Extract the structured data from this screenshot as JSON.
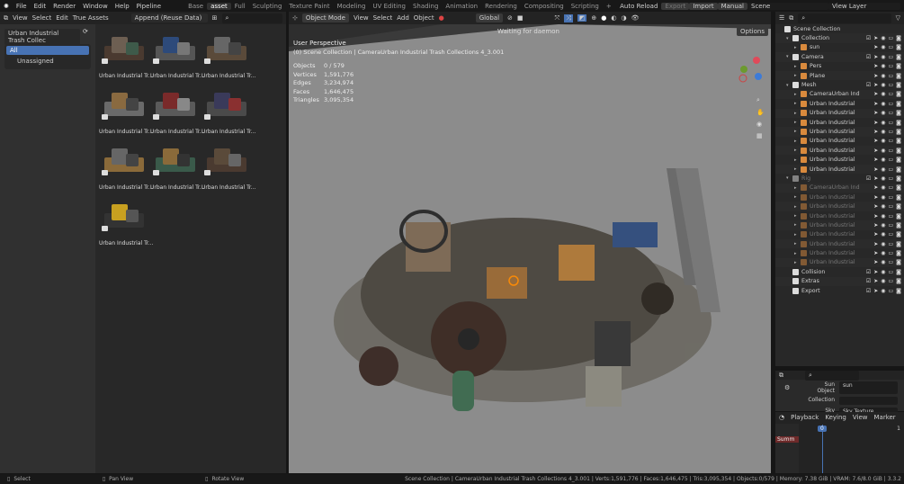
{
  "menu": [
    "File",
    "Edit",
    "Render",
    "Window",
    "Help",
    "Pipeline"
  ],
  "workspaces": [
    {
      "label": "Base"
    },
    {
      "label": "asset",
      "active": true
    },
    {
      "label": "Full"
    },
    {
      "label": "Sculpting"
    },
    {
      "label": "Texture Paint"
    },
    {
      "label": "Modeling"
    },
    {
      "label": "UV Editing"
    },
    {
      "label": "Shading"
    },
    {
      "label": "Animation"
    },
    {
      "label": "Rendering"
    },
    {
      "label": "Compositing"
    },
    {
      "label": "Scripting"
    },
    {
      "label": "+"
    }
  ],
  "topright": {
    "auto_reload": "Auto Reload",
    "export": "Export",
    "import": "Import",
    "manual": "Manual",
    "scene": "Scene",
    "view_layer": "View Layer"
  },
  "asset_browser": {
    "header": [
      "View",
      "Select",
      "Edit",
      "True Assets"
    ],
    "import_method": "Append (Reuse Data)",
    "library": "Urban Industrial Trash Collec",
    "catalogs": [
      {
        "label": "All",
        "active": true
      },
      {
        "label": "Unassigned"
      }
    ],
    "assets": [
      "Urban Industrial Tr...",
      "Urban Industrial Tr...",
      "Urban Industrial Tr...",
      "Urban Industrial Tr...",
      "Urban Industrial Tr...",
      "Urban Industrial Tr...",
      "Urban Industrial Tr...",
      "Urban Industrial Tr...",
      "Urban Industrial Tr...",
      "Urban Industrial Tr..."
    ]
  },
  "viewport": {
    "mode": "Object Mode",
    "menus": [
      "View",
      "Select",
      "Add",
      "Object"
    ],
    "orientation": "Global",
    "options": "Options",
    "daemon": "Waiting for daemon",
    "perspective": "User Perspective",
    "context": "(0) Scene Collection | CameraUrban Industrial Trash Collections 4_3.001",
    "stats": [
      {
        "k": "Objects",
        "v": "0 / 579"
      },
      {
        "k": "Vertices",
        "v": "1,591,776"
      },
      {
        "k": "Edges",
        "v": "3,234,974"
      },
      {
        "k": "Faces",
        "v": "1,646,475"
      },
      {
        "k": "Triangles",
        "v": "3,095,354"
      }
    ]
  },
  "outliner": {
    "rows": [
      {
        "name": "Scene Collection",
        "depth": 0,
        "type": "collection"
      },
      {
        "name": "Collection",
        "depth": 1,
        "type": "collection",
        "check": true
      },
      {
        "name": "sun",
        "depth": 2,
        "type": "light"
      },
      {
        "name": "Camera",
        "depth": 1,
        "type": "collection",
        "check": true
      },
      {
        "name": "Pers",
        "depth": 2,
        "type": "camera"
      },
      {
        "name": "Plane",
        "depth": 2,
        "type": "mesh"
      },
      {
        "name": "Mesh",
        "depth": 1,
        "type": "collection",
        "check": true
      },
      {
        "name": "CameraUrban Ind",
        "depth": 2,
        "type": "object"
      },
      {
        "name": "Urban Industrial",
        "depth": 2,
        "type": "object"
      },
      {
        "name": "Urban Industrial",
        "depth": 2,
        "type": "object"
      },
      {
        "name": "Urban Industrial",
        "depth": 2,
        "type": "object"
      },
      {
        "name": "Urban Industrial",
        "depth": 2,
        "type": "object"
      },
      {
        "name": "Urban Industrial",
        "depth": 2,
        "type": "object"
      },
      {
        "name": "Urban Industrial",
        "depth": 2,
        "type": "object"
      },
      {
        "name": "Urban Industrial",
        "depth": 2,
        "type": "object"
      },
      {
        "name": "Urban Industrial",
        "depth": 2,
        "type": "object"
      },
      {
        "name": "Rig",
        "depth": 1,
        "type": "collection",
        "check": true,
        "dim": true
      },
      {
        "name": "CameraUrban Ind",
        "depth": 2,
        "type": "object",
        "dim": true
      },
      {
        "name": "Urban Industrial",
        "depth": 2,
        "type": "object",
        "dim": true
      },
      {
        "name": "Urban Industrial",
        "depth": 2,
        "type": "object",
        "dim": true
      },
      {
        "name": "Urban Industrial",
        "depth": 2,
        "type": "object",
        "dim": true
      },
      {
        "name": "Urban Industrial",
        "depth": 2,
        "type": "object",
        "dim": true
      },
      {
        "name": "Urban Industrial",
        "depth": 2,
        "type": "object",
        "dim": true
      },
      {
        "name": "Urban Industrial",
        "depth": 2,
        "type": "object",
        "dim": true
      },
      {
        "name": "Urban Industrial",
        "depth": 2,
        "type": "object",
        "dim": true
      },
      {
        "name": "Urban Industrial",
        "depth": 2,
        "type": "object",
        "dim": true
      },
      {
        "name": "Collision",
        "depth": 1,
        "type": "collection",
        "check": true
      },
      {
        "name": "Extras",
        "depth": 1,
        "type": "collection",
        "check": true
      },
      {
        "name": "Export",
        "depth": 1,
        "type": "collection",
        "check": true
      }
    ]
  },
  "properties": {
    "sun_object_label": "Sun Object",
    "sun_object": "sun",
    "collection_label": "Collection",
    "sky_texture_label": "Sky Texture",
    "sky_texture": "Sky Texture"
  },
  "timeline": {
    "menus": [
      "Playback",
      "Keying",
      "View",
      "Marker"
    ],
    "frame": "0",
    "end_marker": "1",
    "summary": "Summ"
  },
  "status": {
    "select": "Select",
    "pan": "Pan View",
    "rotate": "Rotate View",
    "info": "Scene Collection | CameraUrban Industrial Trash Collections 4_3.001 | Verts:1,591,776 | Faces:1,646,475 | Tris:3,095,354 | Objects:0/579 | Memory: 7.38 GiB | VRAM: 7.6/8.0 GiB | 3.3.2"
  },
  "colors": {
    "accent": "#4772b3",
    "object_orange": "#d98a3d",
    "viewport_bg": "#8c8c8c"
  }
}
